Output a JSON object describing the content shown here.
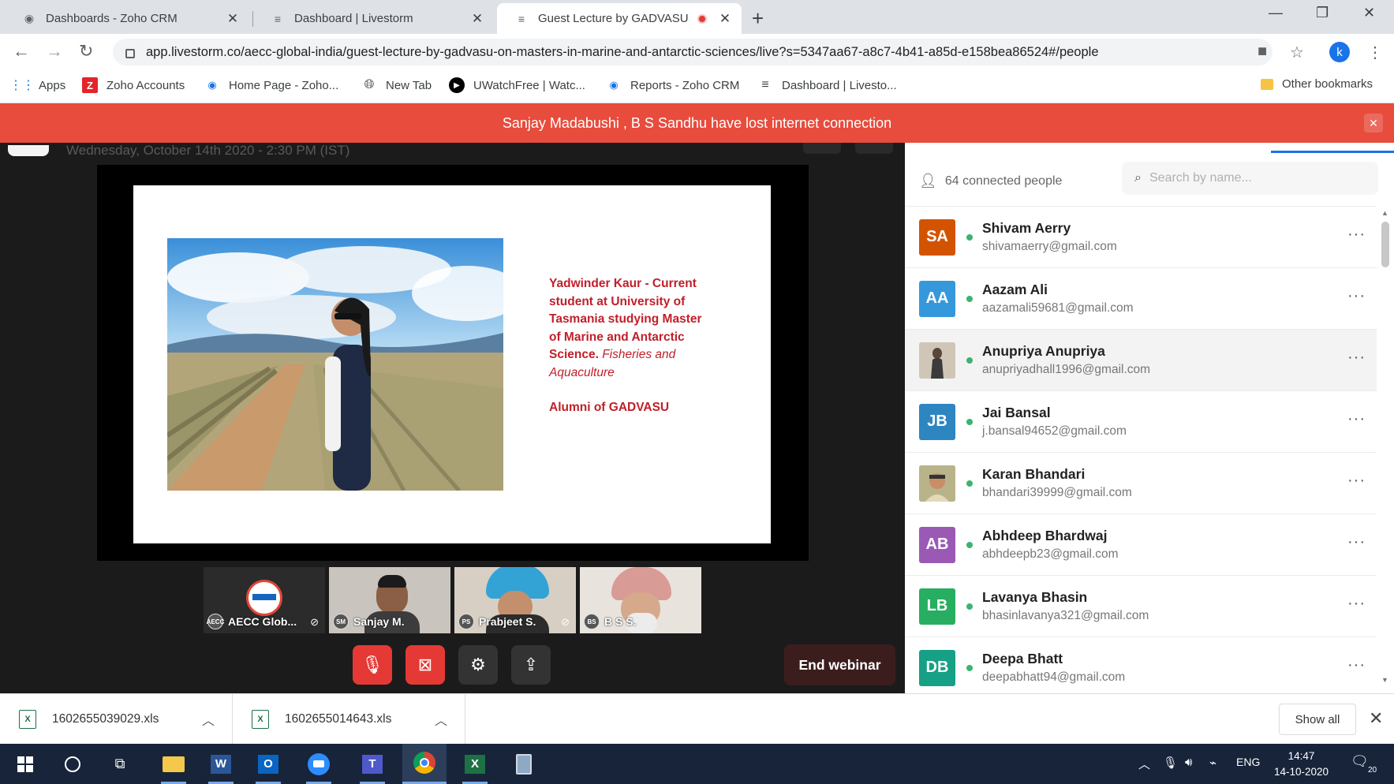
{
  "browser": {
    "tabs": [
      {
        "title": "Dashboards - Zoho CRM"
      },
      {
        "title": "Dashboard | Livestorm"
      },
      {
        "title": "Guest Lecture by GADVASU"
      }
    ],
    "url": "app.livestorm.co/aecc-global-india/guest-lecture-by-gadvasu-on-masters-in-marine-and-antarctic-sciences/live?s=5347aa67-a8c7-4b41-a85d-e158bea86524#/people",
    "profile_initial": "k",
    "bookmarks": [
      {
        "label": "Apps"
      },
      {
        "label": "Zoho Accounts"
      },
      {
        "label": "Home Page - Zoho..."
      },
      {
        "label": "New Tab"
      },
      {
        "label": "UWatchFree | Watc..."
      },
      {
        "label": "Reports - Zoho CRM"
      },
      {
        "label": "Dashboard | Livesto..."
      }
    ],
    "other_bookmarks": "Other bookmarks"
  },
  "alert": {
    "message": "Sanjay Madabushi , B S Sandhu have lost internet connection",
    "color": "#e74c3c"
  },
  "event": {
    "datetime": "Wednesday, October 14th 2020 - 2:30 PM (IST)"
  },
  "slide": {
    "text_line1": "Yadwinder Kaur - Current student at University of Tasmania studying Master of Marine and Antarctic Science.",
    "text_italic": "Fisheries and Aquaculture",
    "alumni": "Alumni of GADVASU"
  },
  "participants_video": [
    {
      "initials": "AECC",
      "label": "AECC Glob...",
      "muted": true
    },
    {
      "initials": "SM",
      "label": "Sanjay M.",
      "muted": false
    },
    {
      "initials": "PS",
      "label": "Prabjeet S.",
      "muted": true
    },
    {
      "initials": "BS",
      "label": "B S S.",
      "muted": false
    }
  ],
  "controls": {
    "end_label": "End webinar"
  },
  "people": {
    "count_label": "64 connected people",
    "search_placeholder": "Search by name...",
    "list": [
      {
        "initials": "SA",
        "name": "Shivam Aerry",
        "email": "shivamaerry@gmail.com",
        "color": "#d35400"
      },
      {
        "initials": "AA",
        "name": "Aazam Ali",
        "email": "aazamali59681@gmail.com",
        "color": "#3498db"
      },
      {
        "initials": "",
        "name": "Anupriya Anupriya",
        "email": "anupriyadhall1996@gmail.com",
        "color": "#8d7b68"
      },
      {
        "initials": "JB",
        "name": "Jai Bansal",
        "email": "j.bansal94652@gmail.com",
        "color": "#2e86c1"
      },
      {
        "initials": "",
        "name": "Karan Bhandari",
        "email": "bhandari39999@gmail.com",
        "color": "#c9a96e"
      },
      {
        "initials": "AB",
        "name": "Abhdeep Bhardwaj",
        "email": "abhdeepb23@gmail.com",
        "color": "#9b59b6"
      },
      {
        "initials": "LB",
        "name": "Lavanya Bhasin",
        "email": "bhasinlavanya321@gmail.com",
        "color": "#27ae60"
      },
      {
        "initials": "DB",
        "name": "Deepa Bhatt",
        "email": "deepabhatt94@gmail.com",
        "color": "#16a085"
      }
    ]
  },
  "downloads": [
    {
      "file": "1602655039029.xls"
    },
    {
      "file": "1602655014643.xls"
    }
  ],
  "downloads_show_all": "Show all",
  "taskbar": {
    "lang": "ENG",
    "time": "14:47",
    "date": "14-10-2020",
    "notifications": "20"
  }
}
